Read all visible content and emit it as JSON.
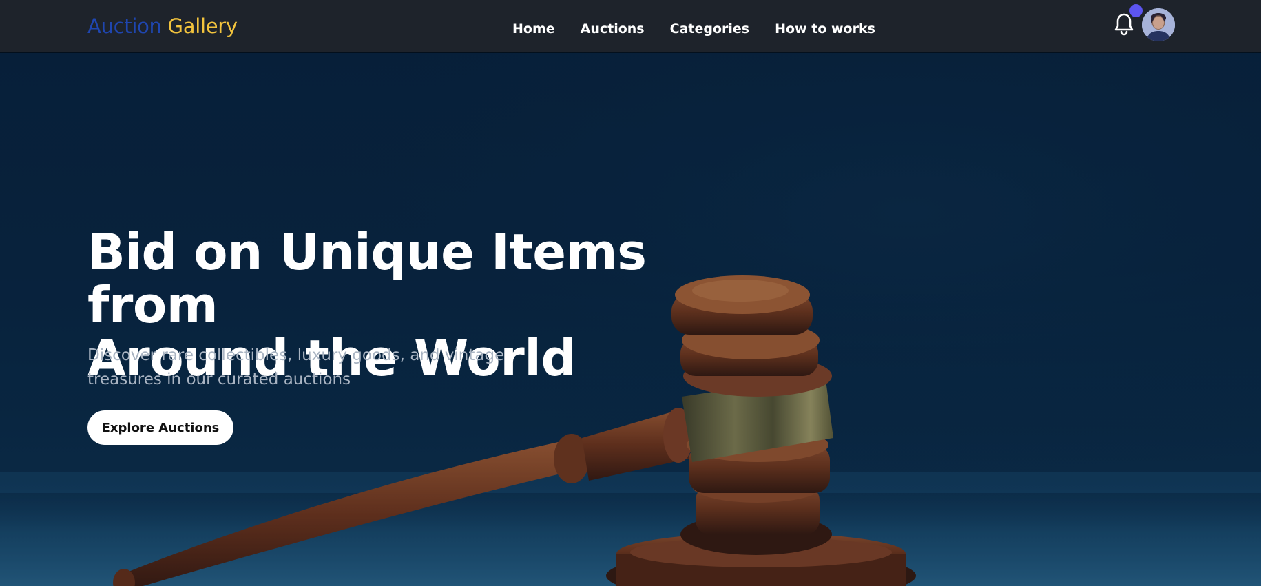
{
  "brand": {
    "name_part1": "Auction",
    "name_part2": "Gallery"
  },
  "nav": {
    "links": [
      {
        "label": "Home"
      },
      {
        "label": "Auctions"
      },
      {
        "label": "Categories"
      },
      {
        "label": "How to works"
      }
    ]
  },
  "header_actions": {
    "notification_icon": "bell-icon",
    "has_unread": true,
    "avatar": "user-avatar"
  },
  "hero": {
    "title_line1": "Bid on Unique Items from",
    "title_line2": "Around the World",
    "subtitle_line1": "Discover rare collectibles, luxury goods, and vintage",
    "subtitle_line2": "treasures in our curated auctions",
    "cta_label": "Explore Auctions"
  },
  "colors": {
    "brand_primary": "#1f46b0",
    "brand_accent": "#f2c33d",
    "navbar_bg": "#1e232b",
    "notification_dot": "#5d55f0",
    "hero_bg": "#07213b"
  }
}
